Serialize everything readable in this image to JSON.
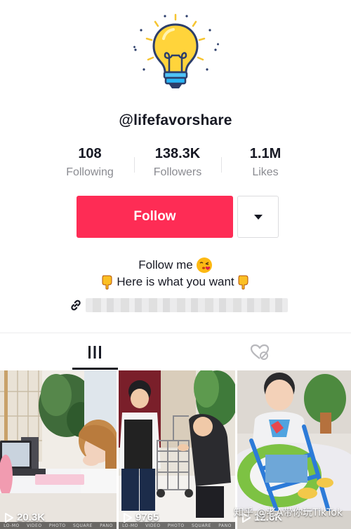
{
  "profile": {
    "username": "@lifefavorshare",
    "avatar_icon": "lightbulb-icon",
    "stats": [
      {
        "value": "108",
        "label": "Following"
      },
      {
        "value": "138.3K",
        "label": "Followers"
      },
      {
        "value": "1.1M",
        "label": "Likes"
      }
    ],
    "follow_label": "Follow",
    "accent_color": "#fe2c55",
    "bio_line1": "Follow me",
    "bio_line2": "Here is what you want",
    "link_icon": "link-icon"
  },
  "tabs": [
    {
      "name": "videos",
      "icon": "grid-icon",
      "active": true
    },
    {
      "name": "liked",
      "icon": "liked-hidden-icon",
      "active": false
    }
  ],
  "videos": [
    {
      "views": "20.3K",
      "camera_modes": [
        "LO-MO",
        "VIDEO",
        "PHOTO",
        "SQUARE",
        "PANO"
      ]
    },
    {
      "views": "9765",
      "camera_modes": [
        "LO-MO",
        "VIDEO",
        "PHOTO",
        "SQUARE",
        "PANO"
      ]
    },
    {
      "views": "12.6K"
    }
  ],
  "watermark": "知乎 @老A带你玩TikTok"
}
